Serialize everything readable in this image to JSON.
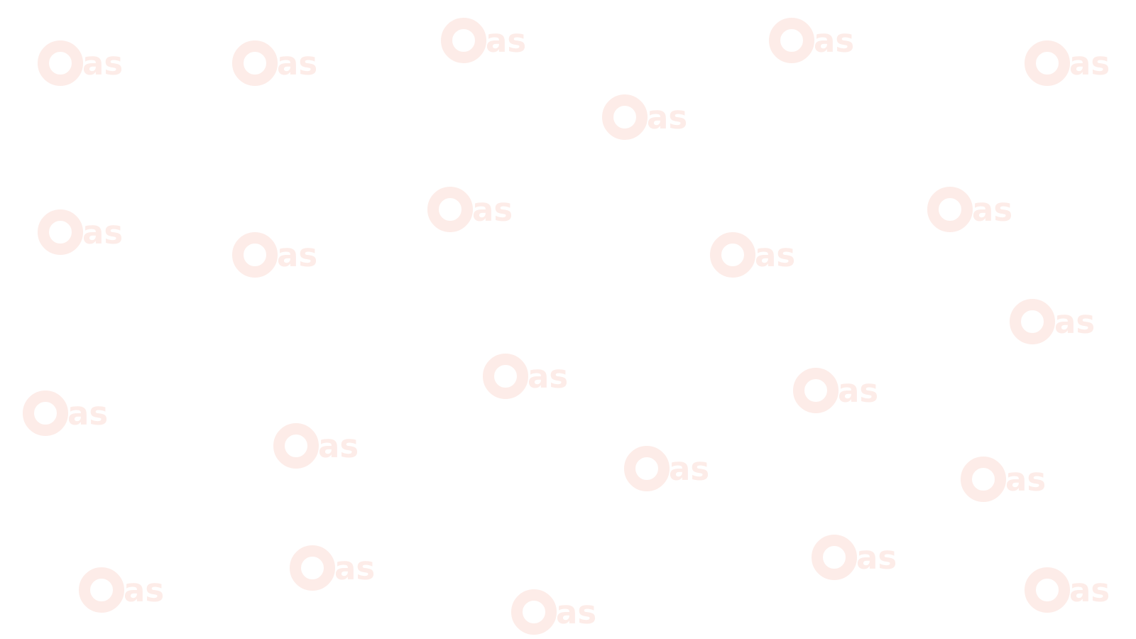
{
  "background": "#ffffff",
  "watermark": {
    "text": "as",
    "icon": "ring-o-icon",
    "color": "#fdece8",
    "count": 23
  }
}
